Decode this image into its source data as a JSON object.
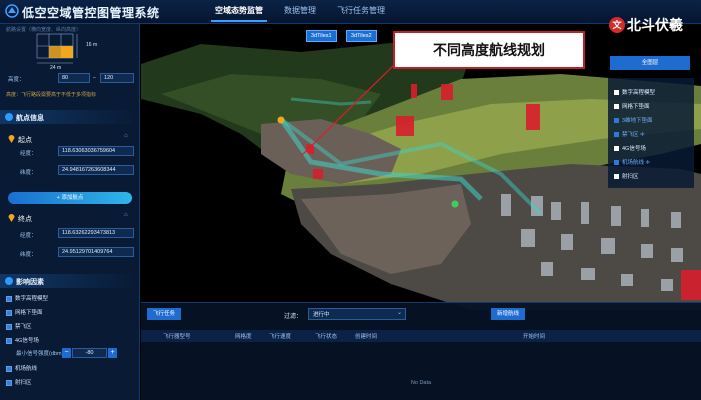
{
  "app": {
    "title": "低空空域管控图管理系统"
  },
  "nav": {
    "tabs": [
      {
        "label": "空域态势监管",
        "active": true
      },
      {
        "label": "数据管理",
        "active": false
      },
      {
        "label": "飞行任务管理",
        "active": false
      }
    ]
  },
  "left": {
    "grid_caption": "航路设置（横向宽度、纵向高度）",
    "grid_height_label": "16 m",
    "grid_width_label": "24 m",
    "altitude_label": "高度：",
    "altitude_min": "80",
    "altitude_max": "120",
    "warning": "高度：飞行路段需要高于不低于多项指标",
    "waypoint_section": "航点信息",
    "start": {
      "label": "起点",
      "lng_label": "经度：",
      "lng": "118.63063036759604",
      "lat_label": "纬度：",
      "lat": "24.948167263608344"
    },
    "add_button": "+ 添加航点",
    "end": {
      "label": "终点",
      "lng_label": "经度：",
      "lng": "118.63262293473813",
      "lat_label": "纬度：",
      "lat": "24.95129701409764"
    },
    "factor_section": "影响因素",
    "factors": [
      "数字高程模型",
      "网格下垫面",
      "禁飞区",
      "4G信号场"
    ],
    "signal_label": "最小信号强度(dbm)：",
    "signal_value": "-80",
    "factors_bottom": [
      "机场航线",
      "射扫区"
    ]
  },
  "map": {
    "view_buttons": [
      "3dTiles1",
      "3dTiles2"
    ],
    "annotation": "不同高度航线规划",
    "watermark": "北斗伏羲",
    "layers_button": "全图层",
    "layers": [
      {
        "label": "数字高程模型",
        "on": false
      },
      {
        "label": "网格下垫面",
        "on": false
      },
      {
        "label": "3维地下垫面",
        "on": true
      },
      {
        "label": "禁飞区",
        "on": true
      },
      {
        "label": "4G信号场",
        "on": false
      },
      {
        "label": "机场航线",
        "on": true
      },
      {
        "label": "射扫区",
        "on": false
      }
    ]
  },
  "table": {
    "task_button": "飞行任务",
    "filter_label": "过滤：",
    "filter_value": "进行中",
    "new_button": "新增航线",
    "columns": [
      "飞行器型号",
      "网格度",
      "飞行速度",
      "飞行状态",
      "创建时间",
      "开始时间"
    ],
    "empty": "No Data"
  },
  "colors": {
    "accent": "#1f6cd1",
    "route": "#3fd3c8",
    "no_fly": "#d81e2c",
    "annotation_border": "#c0202b"
  }
}
